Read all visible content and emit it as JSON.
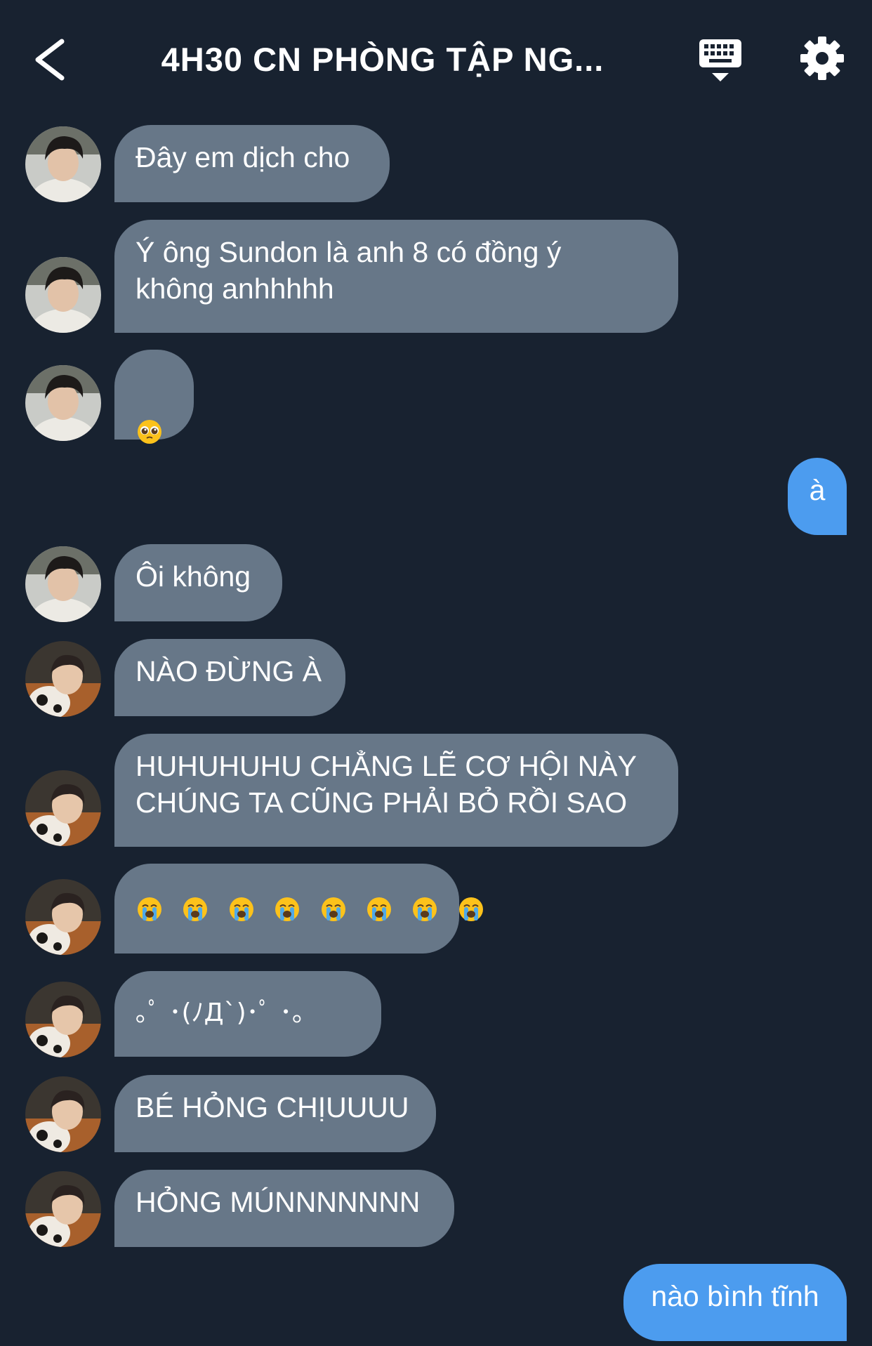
{
  "header": {
    "title": "4H30 CN PHÒNG TẬP NG...",
    "back_icon": "chevron-left-icon",
    "keyboard_icon": "keyboard-icon",
    "settings_icon": "gear-icon"
  },
  "colors": {
    "background": "#182230",
    "incoming_bubble": "#677788",
    "outgoing_bubble": "#4c9cef"
  },
  "messages": [
    {
      "sender": "user-a",
      "direction": "incoming",
      "text": "Đây em dịch cho"
    },
    {
      "sender": "user-a",
      "direction": "incoming",
      "text": "Ý ông Sundon là anh 8 có đồng ý\nkhông anhhhhh"
    },
    {
      "sender": "user-a",
      "direction": "incoming",
      "emoji": "pleading-face-emoji",
      "emoji_count": 1
    },
    {
      "sender": "me",
      "direction": "outgoing",
      "text": "à"
    },
    {
      "sender": "user-a",
      "direction": "incoming",
      "text": "Ôi không"
    },
    {
      "sender": "user-b",
      "direction": "incoming",
      "text": "NÀO ĐỪNG À"
    },
    {
      "sender": "user-b",
      "direction": "incoming",
      "text": "HUHUHUHU CHẲNG LẼ CƠ HỘI NÀY\nCHÚNG TA CŨNG PHẢI BỎ RỒI SAO"
    },
    {
      "sender": "user-b",
      "direction": "incoming",
      "emoji": "loudly-crying-face-emoji",
      "emoji_count": 8
    },
    {
      "sender": "user-b",
      "direction": "incoming",
      "text": "｡ﾟ ･(ﾉД`)･ﾟ ･｡"
    },
    {
      "sender": "user-b",
      "direction": "incoming",
      "text": "BÉ HỎNG CHỊUUUU"
    },
    {
      "sender": "user-b",
      "direction": "incoming",
      "text": "HỎNG MÚNNNNNNN"
    },
    {
      "sender": "me",
      "direction": "outgoing",
      "text": "nào bình tĩnh"
    }
  ]
}
